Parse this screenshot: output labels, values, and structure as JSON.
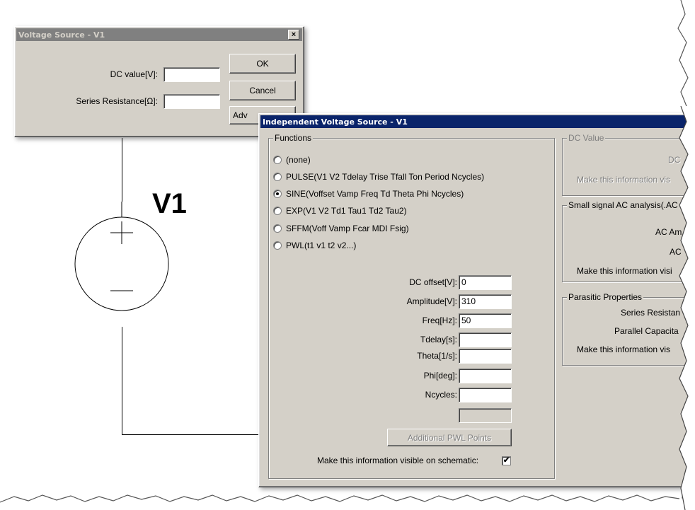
{
  "schematic": {
    "component_label": "V1"
  },
  "small_dialog": {
    "title": "Voltage Source - V1",
    "close_glyph": "×",
    "dc_value_label": "DC value[V]:",
    "dc_value": "",
    "series_resistance_label": "Series Resistance[Ω]:",
    "series_resistance_value": "",
    "ok_label": "OK",
    "cancel_label": "Cancel",
    "advanced_label": "Adv"
  },
  "main_dialog": {
    "title": "Independent Voltage Source - V1",
    "functions": {
      "legend": "Functions",
      "options": [
        {
          "label": "(none)",
          "selected": false
        },
        {
          "label": "PULSE(V1 V2 Tdelay Trise Tfall Ton Period Ncycles)",
          "selected": false
        },
        {
          "label": "SINE(Voffset Vamp Freq Td Theta Phi Ncycles)",
          "selected": true
        },
        {
          "label": "EXP(V1 V2 Td1 Tau1 Td2 Tau2)",
          "selected": false
        },
        {
          "label": "SFFM(Voff Vamp Fcar MDI Fsig)",
          "selected": false
        },
        {
          "label": "PWL(t1 v1 t2 v2...)",
          "selected": false
        }
      ],
      "params": [
        {
          "label": "DC offset[V]:",
          "value": "0"
        },
        {
          "label": "Amplitude[V]:",
          "value": "310"
        },
        {
          "label": "Freq[Hz]:",
          "value": "50"
        },
        {
          "label": "Tdelay[s]:",
          "value": ""
        },
        {
          "label": "Theta[1/s]:",
          "value": ""
        },
        {
          "label": "Phi[deg]:",
          "value": ""
        },
        {
          "label": "Ncycles:",
          "value": ""
        }
      ],
      "additional_pwl_label": "Additional PWL Points",
      "visible_label": "Make this information visible on schematic:",
      "visible_checked": true,
      "check_glyph": "✔"
    },
    "dc_value_group": {
      "legend": "DC Value",
      "field_label": "DC",
      "visible_label": "Make this information vis"
    },
    "ac_group": {
      "legend": "Small signal AC analysis(.AC",
      "amp_label": "AC Am",
      "phase_label": "AC",
      "visible_label": "Make this information visi"
    },
    "parasitic_group": {
      "legend": "Parasitic Properties",
      "series_label": "Series Resistan",
      "parallel_label": "Parallel Capacita",
      "visible_label": "Make this information vis"
    }
  }
}
